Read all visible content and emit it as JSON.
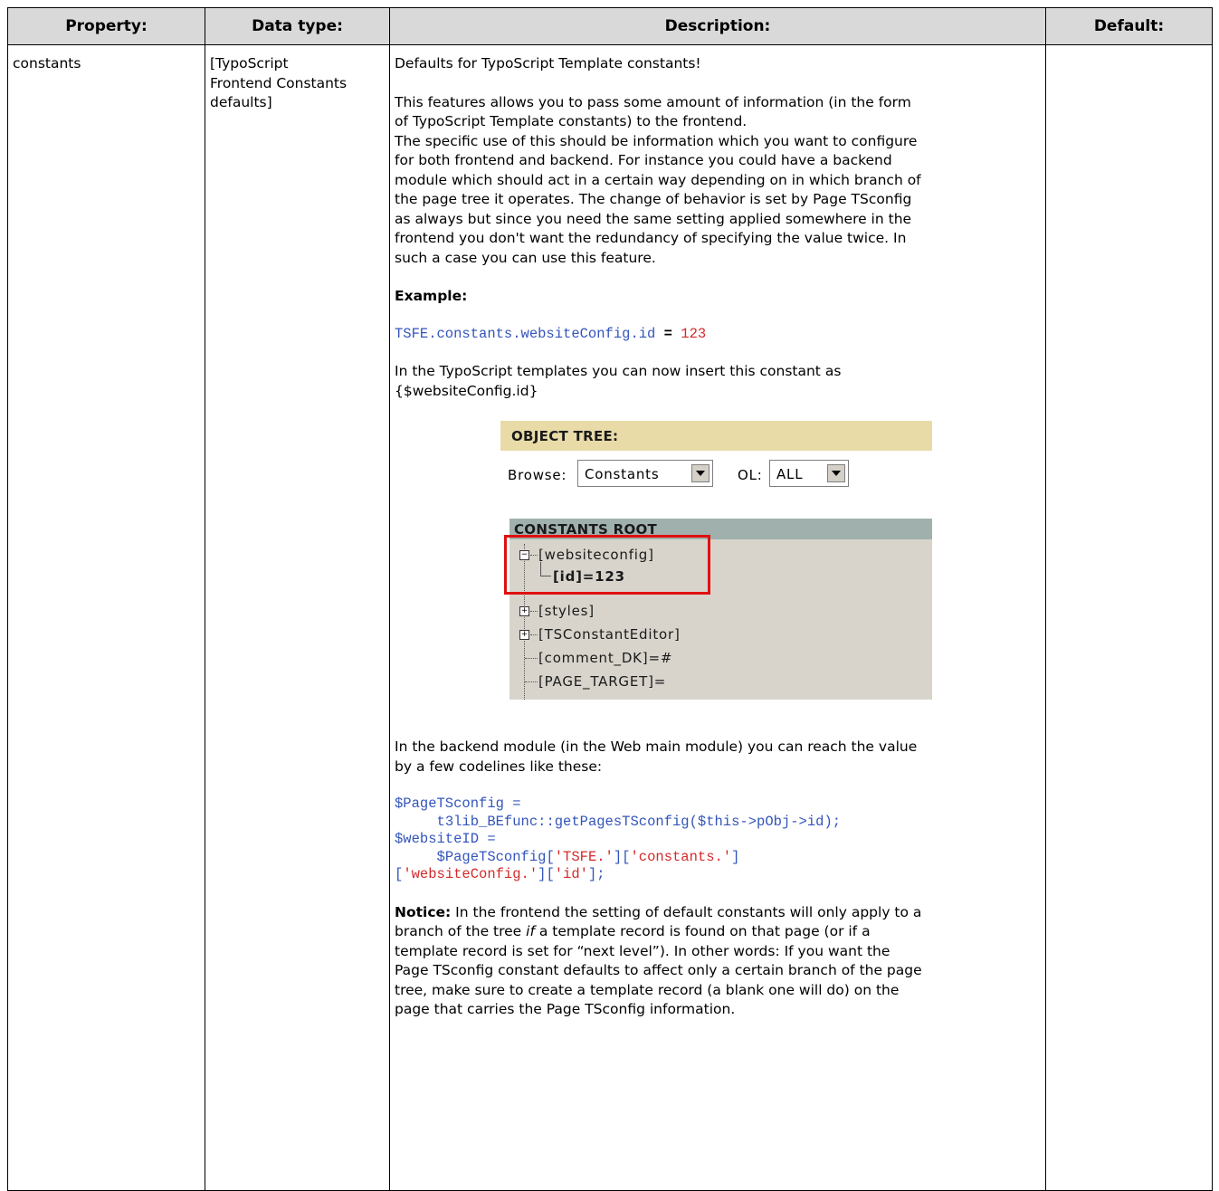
{
  "table": {
    "headers": [
      "Property:",
      "Data type:",
      "Description:",
      "Default:"
    ],
    "row": {
      "property": "constants",
      "data_type": [
        "[TypoScript",
        "Frontend Constants",
        "defaults]"
      ],
      "default": ""
    }
  },
  "description": {
    "intro": "Defaults for TypoScript Template constants!",
    "para1": [
      "This features allows you to pass some amount of information (in the form",
      "of TypoScript Template constants) to the frontend."
    ],
    "para2": [
      "The specific use of this should be information which you want to configure",
      "for both frontend and backend. For instance you could have a backend",
      "module which should act in a certain way depending on in which branch of",
      "the page tree it operates. The change of behavior is set by Page TSconfig",
      "as always but since you need the same setting applied somewhere in the",
      "frontend you don't want the redundancy of specifying the value twice. In",
      "such a case you can use this feature."
    ],
    "example_heading": "Example:",
    "example_code": {
      "lhs": "TSFE.constants.websiteConfig.id",
      "op": " = ",
      "rhs": "123"
    },
    "templates_text": [
      "In the TypoScript templates you can now insert this constant as",
      "{$websiteConfig.id}"
    ],
    "backend_text": [
      "In the backend module (in the Web main module) you can reach the value",
      "by a few codelines like these:"
    ],
    "code": {
      "l1": "$PageTSconfig",
      "l1_op": " =",
      "l2_indent": "     ",
      "l2_a": "t3lib_BEfunc",
      "l2_b": "::",
      "l2_c": "getPagesTSconfig",
      "l2_d": "(",
      "l2_e": "$this",
      "l2_f": "->",
      "l2_g": "pObj",
      "l2_h": "->",
      "l2_i": "id",
      "l2_j": ");",
      "l3": "$websiteID",
      "l3_op": " =",
      "l4_indent": "     ",
      "l4_a": "$PageTSconfig",
      "l4_b": "[",
      "l4_c": "'TSFE.'",
      "l4_d": "][",
      "l4_e": "'constants.'",
      "l4_f": "]",
      "l5_a": "[",
      "l5_b": "'websiteConfig.'",
      "l5_c": "][",
      "l5_d": "'id'",
      "l5_e": "];"
    },
    "notice_label": "Notice:",
    "notice_1": " In the frontend the setting of default constants will only apply to a",
    "notice_2a": "branch of the tree ",
    "notice_2_if": "if",
    "notice_2b": " a template record is found on that page (or if a",
    "notice_3": "template record is set for “next level”). In other words: If you want the",
    "notice_4": "Page TSconfig constant defaults to affect only a certain branch of the page",
    "notice_5": "tree, make sure to create a template record (a blank one will do) on the",
    "notice_6": "page that carries the Page TSconfig information."
  },
  "figure": {
    "bar_title": "OBJECT TREE:",
    "browse_label": "Browse:",
    "browse_value": "Constants",
    "ol_label": "OL:",
    "ol_value": "ALL",
    "tree_title": "CONSTANTS ROOT",
    "tree_items": [
      "[websiteconfig]",
      "[id]=123",
      "[styles]",
      "[TSConstantEditor]",
      "[comment_DK]=#",
      "[PAGE_TARGET]="
    ]
  }
}
